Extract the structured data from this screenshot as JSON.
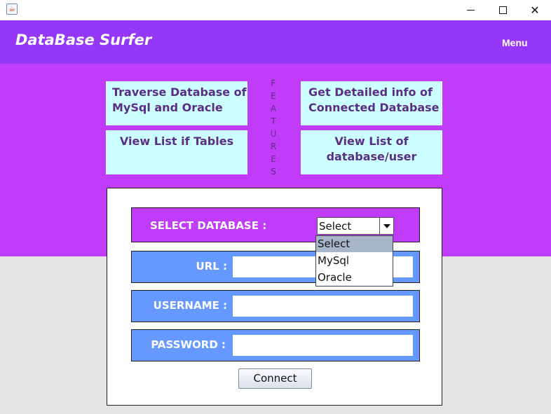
{
  "window": {
    "app_icon": "java-coffee-icon",
    "controls": [
      "minimize-icon",
      "maximize-icon",
      "close-icon"
    ],
    "close_glyph": "✕"
  },
  "header": {
    "title": "DataBase Surfer",
    "menu_label": "Menu"
  },
  "features": {
    "vertical_label": [
      "F",
      "E",
      "A",
      "T",
      "U",
      "R",
      "E",
      "S"
    ],
    "cards": [
      "Traverse Database of\nMySql and Oracle",
      "Get Detailed info of\nConnected Database",
      "View List if Tables",
      "View List of\ndatabase/user"
    ]
  },
  "form": {
    "select_label": "SELECT DATABASE :",
    "select_value": "Select",
    "select_options": [
      "Select",
      "MySql",
      "Oracle"
    ],
    "selected_option_index": 0,
    "url_label": "URL :",
    "url_value": "",
    "username_label": "USERNAME :",
    "username_value": "",
    "password_label": "PASSWORD :",
    "password_value": "",
    "connect_label": "Connect"
  },
  "colors": {
    "header": "#9437f6",
    "band": "#c13cf8",
    "card": "#ccffff",
    "field_row": "#6699ff",
    "card_text": "#5b2e86"
  }
}
